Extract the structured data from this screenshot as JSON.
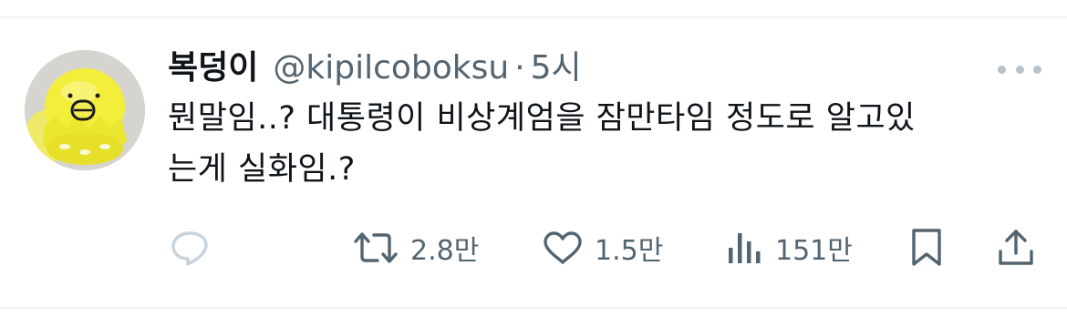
{
  "tweet": {
    "display_name": "복덩이",
    "handle": "@kipilcoboksu",
    "separator": "·",
    "time": "5시",
    "text_lines": [
      "뭔말임..? 대통령이 비상계엄을 잠만타임 정도로 알고있",
      "는게 실화임.?"
    ]
  },
  "actions": {
    "reply": {
      "icon": "reply-icon",
      "count": ""
    },
    "retweet": {
      "icon": "retweet-icon",
      "count": "2.8만"
    },
    "like": {
      "icon": "heart-icon",
      "count": "1.5만"
    },
    "views": {
      "icon": "views-icon",
      "count": "151만"
    },
    "bookmark": {
      "icon": "bookmark-icon"
    },
    "share": {
      "icon": "share-icon"
    }
  },
  "colors": {
    "text": "#0f1419",
    "secondary": "#536471",
    "reply_icon_muted": "#c8d2dc",
    "divider": "#eff1f3"
  }
}
